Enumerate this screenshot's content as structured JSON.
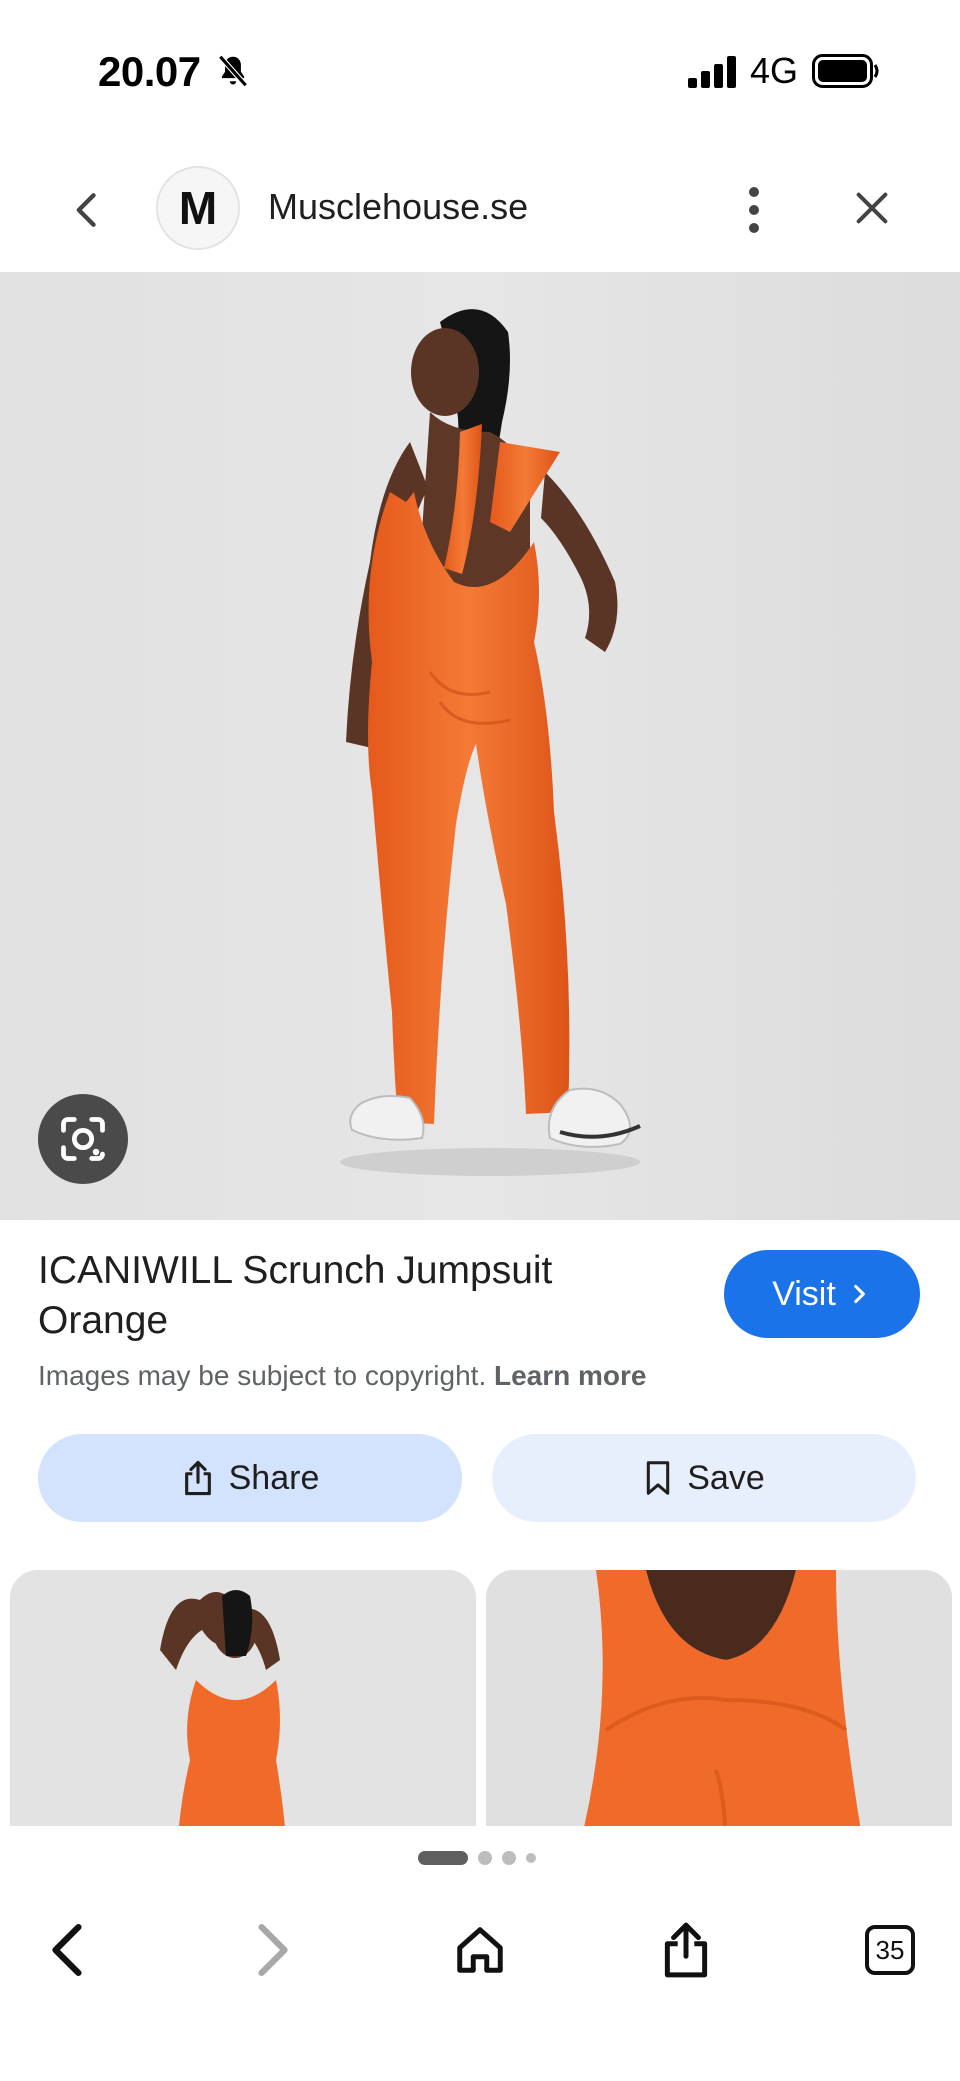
{
  "status_bar": {
    "time": "20.07",
    "network": "4G"
  },
  "header": {
    "site_initial": "M",
    "site_name": "Musclehouse.se"
  },
  "product": {
    "title": "ICANIWILL Scrunch Jumpsuit Orange",
    "visit_label": "Visit",
    "copyright_text": "Images may be subject to copyright.",
    "learn_more": "Learn more"
  },
  "actions": {
    "share_label": "Share",
    "save_label": "Save"
  },
  "bottom_nav": {
    "tab_count": "35"
  },
  "colors": {
    "accent": "#1a73e8",
    "share_bg": "#d3e3fd",
    "save_bg": "#e8effc",
    "garment": "#f06a2a"
  },
  "icons": [
    "bell-muted-icon",
    "signal-icon",
    "battery-icon",
    "chevron-left-icon",
    "more-vert-icon",
    "close-icon",
    "google-lens-icon",
    "chevron-right-icon",
    "share-icon",
    "bookmark-icon",
    "back-icon",
    "forward-icon",
    "home-icon",
    "tabs-icon"
  ]
}
